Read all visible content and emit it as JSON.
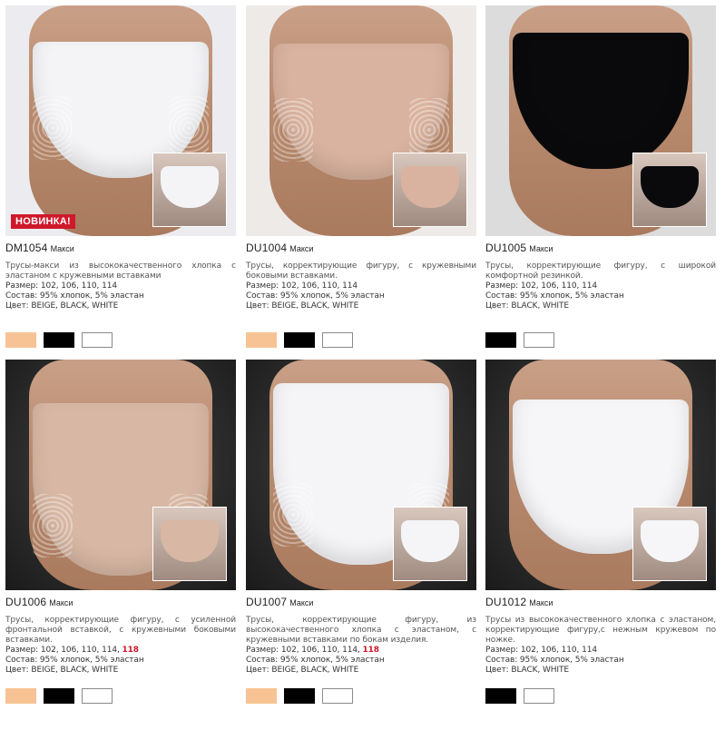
{
  "products": [
    {
      "code": "DM1054",
      "model": "Макси",
      "badge": "НОВИНКА!",
      "description": "Трусы-макси из высококачественного хлопка с эластаном с кружевными вставками",
      "size_label": "Размер: ",
      "sizes": "102, 106, 110, 114",
      "size_extra": "",
      "composition": "Состав: 95% хлопок, 5% эластан",
      "colors_text": "Цвет: BEIGE, BLACK, WHITE",
      "garment_color": "#f4f4f7",
      "swatches": [
        "#f7c394",
        "#000000",
        "#ffffff"
      ]
    },
    {
      "code": "DU1004",
      "model": "Макси",
      "badge": "",
      "description": "Трусы, корректирующие фигуру, с кружевными боковыми вставками.",
      "size_label": "Размер: ",
      "sizes": "102, 106, 110, 114",
      "size_extra": "",
      "composition": "Состав: 95% хлопок, 5% эластан",
      "colors_text": "Цвет: BEIGE, BLACK, WHITE",
      "garment_color": "#d9b39f",
      "swatches": [
        "#f7c394",
        "#000000",
        "#ffffff"
      ]
    },
    {
      "code": "DU1005",
      "model": "Макси",
      "badge": "",
      "description": "Трусы, корректирующие фигуру, с широкой комфортной резинкой.",
      "size_label": "Размер: ",
      "sizes": "102, 106, 110, 114",
      "size_extra": "",
      "composition": "Состав: 95% хлопок, 5% эластан",
      "colors_text": "Цвет: BLACK, WHITE",
      "garment_color": "#0a0a0c",
      "swatches": [
        "#000000",
        "#ffffff"
      ]
    },
    {
      "code": "DU1006",
      "model": "Макси",
      "badge": "",
      "description": "Трусы, корректирующие фигуру, с усиленной фронтальной вставкой, с кружевными боковыми вставками.",
      "size_label": "Размер: ",
      "sizes": "102, 106, 110, 114, ",
      "size_extra": "118",
      "composition": "Состав: 95% хлопок, 5% эластан",
      "colors_text": "Цвет: BEIGE, BLACK, WHITE",
      "garment_color": "#d8b8a4",
      "swatches": [
        "#f7c394",
        "#000000",
        "#ffffff"
      ]
    },
    {
      "code": "DU1007",
      "model": "Макси",
      "badge": "",
      "description": "Трусы, корректирующие фигуру, из высококачественного хлопка с эластаном, с кружевными вставками по бокам изделия.",
      "size_label": "Размер: ",
      "sizes": "102, 106, 110, 114, ",
      "size_extra": "118",
      "composition": "Состав: 95% хлопок, 5% эластан",
      "colors_text": "Цвет: BEIGE, BLACK, WHITE",
      "garment_color": "#f5f5f8",
      "swatches": [
        "#f7c394",
        "#000000",
        "#ffffff"
      ]
    },
    {
      "code": "DU1012",
      "model": "Макси",
      "badge": "",
      "description": "Трусы из высококачественного хлопка с эластаном, корректирующие фигуру,с нежным кружевом по ножке.",
      "size_label": "Размер: ",
      "sizes": "102, 106, 110, 114",
      "size_extra": "",
      "composition": "Состав: 95% хлопок, 5% эластан",
      "colors_text": "Цвет: BLACK, WHITE",
      "garment_color": "#f6f6f8",
      "swatches": [
        "#000000",
        "#ffffff"
      ]
    }
  ]
}
